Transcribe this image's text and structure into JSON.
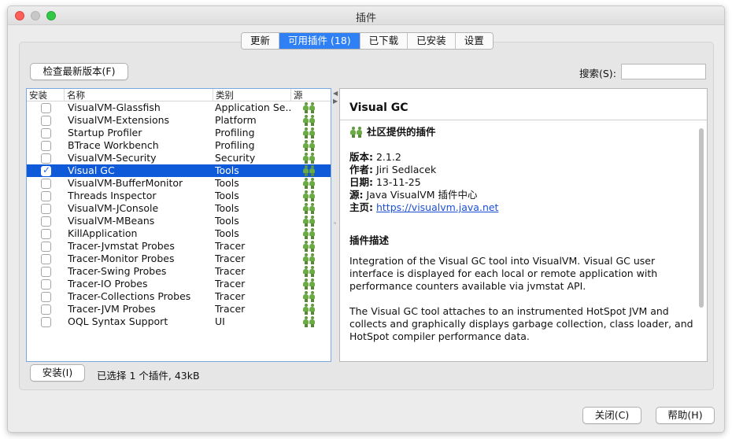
{
  "window": {
    "title": "插件"
  },
  "tabs": [
    {
      "label": "更新",
      "active": false
    },
    {
      "label": "可用插件 (18)",
      "active": true
    },
    {
      "label": "已下载",
      "active": false
    },
    {
      "label": "已安装",
      "active": false
    },
    {
      "label": "设置",
      "active": false
    }
  ],
  "toolbar": {
    "check_updates_label": "检查最新版本(F)"
  },
  "search": {
    "label": "搜索(S):",
    "value": ""
  },
  "table": {
    "columns": [
      "安装",
      "名称",
      "类别",
      "源"
    ],
    "rows": [
      {
        "name": "VisualVM-Glassfish",
        "category": "Application Se...",
        "checked": false,
        "selected": false
      },
      {
        "name": "VisualVM-Extensions",
        "category": "Platform",
        "checked": false,
        "selected": false
      },
      {
        "name": "Startup Profiler",
        "category": "Profiling",
        "checked": false,
        "selected": false
      },
      {
        "name": "BTrace Workbench",
        "category": "Profiling",
        "checked": false,
        "selected": false
      },
      {
        "name": "VisualVM-Security",
        "category": "Security",
        "checked": false,
        "selected": false
      },
      {
        "name": "Visual GC",
        "category": "Tools",
        "checked": true,
        "selected": true
      },
      {
        "name": "VisualVM-BufferMonitor",
        "category": "Tools",
        "checked": false,
        "selected": false
      },
      {
        "name": "Threads Inspector",
        "category": "Tools",
        "checked": false,
        "selected": false
      },
      {
        "name": "VisualVM-JConsole",
        "category": "Tools",
        "checked": false,
        "selected": false
      },
      {
        "name": "VisualVM-MBeans",
        "category": "Tools",
        "checked": false,
        "selected": false
      },
      {
        "name": "KillApplication",
        "category": "Tools",
        "checked": false,
        "selected": false
      },
      {
        "name": "Tracer-Jvmstat Probes",
        "category": "Tracer",
        "checked": false,
        "selected": false
      },
      {
        "name": "Tracer-Monitor Probes",
        "category": "Tracer",
        "checked": false,
        "selected": false
      },
      {
        "name": "Tracer-Swing Probes",
        "category": "Tracer",
        "checked": false,
        "selected": false
      },
      {
        "name": "Tracer-IO Probes",
        "category": "Tracer",
        "checked": false,
        "selected": false
      },
      {
        "name": "Tracer-Collections Probes",
        "category": "Tracer",
        "checked": false,
        "selected": false
      },
      {
        "name": "Tracer-JVM Probes",
        "category": "Tracer",
        "checked": false,
        "selected": false
      },
      {
        "name": "OQL Syntax Support",
        "category": "UI",
        "checked": false,
        "selected": false
      }
    ],
    "source_icon": "community-people-icon"
  },
  "detail": {
    "title": "Visual GC",
    "community_label": "社区提供的插件",
    "version_key": "版本:",
    "version_value": " 2.1.2",
    "author_key": "作者:",
    "author_value": " Jiri Sedlacek",
    "date_key": "日期:",
    "date_value": " 13-11-25",
    "source_key": "源:",
    "source_value": " Java VisualVM 插件中心",
    "homepage_key": "主页:",
    "homepage_value": "https://visualvm.java.net",
    "description_title": "插件描述",
    "description_p1": "Integration of the Visual GC tool into VisualVM. Visual GC user interface is displayed for each local or remote application with performance counters available via jvmstat API.",
    "description_p2": "The Visual GC tool attaches to an instrumented HotSpot JVM and collects and graphically displays garbage collection, class loader, and HotSpot compiler performance data."
  },
  "footer": {
    "install_label": "安装(I)",
    "status": "已选择 1 个插件, 43kB",
    "close_label": "关闭(C)",
    "help_label": "帮助(H)"
  },
  "colors": {
    "accent": "#2f7ff5",
    "selection": "#0f5ad8",
    "link": "#1a4fd6"
  }
}
